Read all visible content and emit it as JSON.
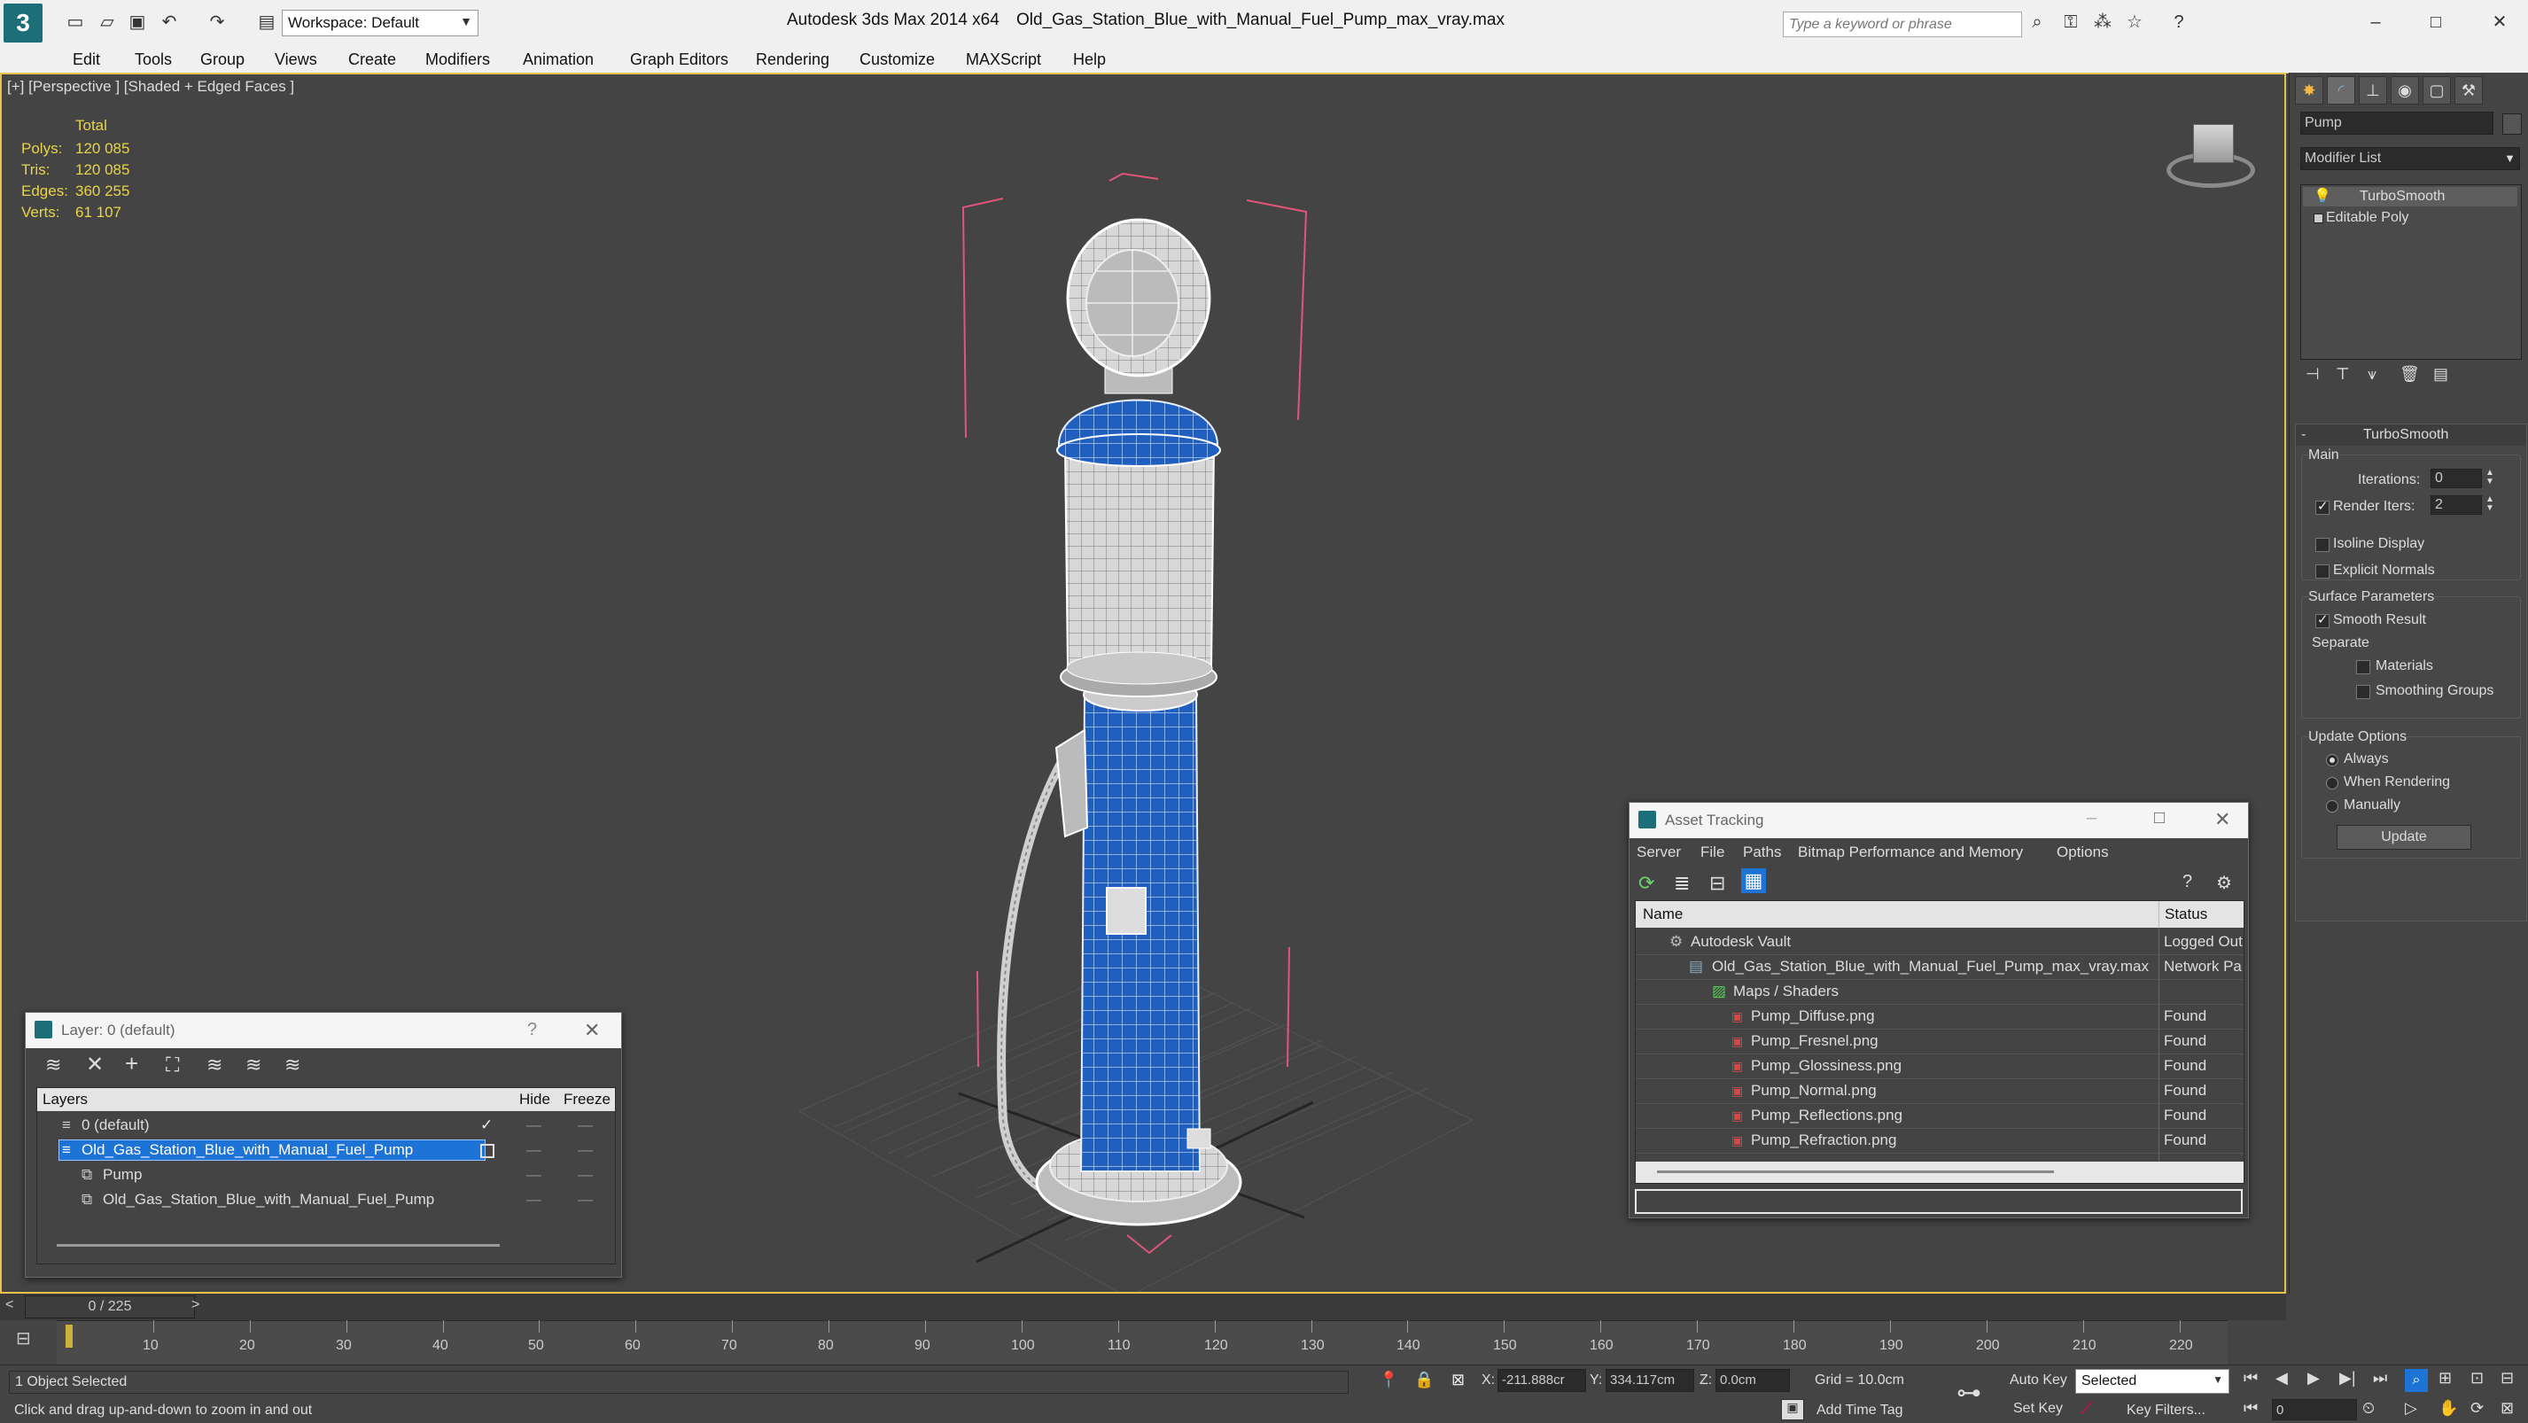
{
  "app": {
    "title": "Autodesk 3ds Max  2014 x64",
    "file": "Old_Gas_Station_Blue_with_Manual_Fuel_Pump_max_vray.max",
    "workspace": "Workspace: Default",
    "search_placeholder": "Type a keyword or phrase"
  },
  "menu": [
    "Edit",
    "Tools",
    "Group",
    "Views",
    "Create",
    "Modifiers",
    "Animation",
    "Graph Editors",
    "Rendering",
    "Customize",
    "MAXScript",
    "Help"
  ],
  "viewport": {
    "label": "[+] [Perspective ] [Shaded + Edged Faces ]",
    "stats_header": "Total",
    "stats": [
      {
        "label": "Polys:",
        "value": "120 085"
      },
      {
        "label": "Tris:",
        "value": "120 085"
      },
      {
        "label": "Edges:",
        "value": "360 255"
      },
      {
        "label": "Verts:",
        "value": "61 107"
      }
    ]
  },
  "command_panel": {
    "object_name": "Pump",
    "modifier_list": "Modifier List",
    "stack": [
      "TurboSmooth",
      "Editable Poly"
    ],
    "rollout_title": "TurboSmooth",
    "main_label": "Main",
    "iterations_label": "Iterations:",
    "iterations_value": "0",
    "render_iters_label": "Render Iters:",
    "render_iters_value": "2",
    "isoline": "Isoline Display",
    "explicit_normals": "Explicit Normals",
    "surface_params": "Surface Parameters",
    "smooth_result": "Smooth Result",
    "separate": "Separate",
    "materials": "Materials",
    "smoothing_groups": "Smoothing Groups",
    "update_options": "Update Options",
    "always": "Always",
    "when_rendering": "When Rendering",
    "manually": "Manually",
    "update_button": "Update"
  },
  "layer_window": {
    "title": "Layer: 0 (default)",
    "col_layers": "Layers",
    "col_hide": "Hide",
    "col_freeze": "Freeze",
    "rows": [
      {
        "label": "0 (default)",
        "indent": 1
      },
      {
        "label": "Old_Gas_Station_Blue_with_Manual_Fuel_Pump",
        "indent": 1,
        "selected": true
      },
      {
        "label": "Pump",
        "indent": 2
      },
      {
        "label": "Old_Gas_Station_Blue_with_Manual_Fuel_Pump",
        "indent": 2
      }
    ]
  },
  "asset_window": {
    "title": "Asset Tracking",
    "menu": [
      "Server",
      "File",
      "Paths",
      "Bitmap Performance and Memory",
      "Options"
    ],
    "col_name": "Name",
    "col_status": "Status",
    "rows": [
      {
        "name": "Autodesk Vault",
        "status": "Logged Out",
        "indent": 1
      },
      {
        "name": "Old_Gas_Station_Blue_with_Manual_Fuel_Pump_max_vray.max",
        "status": "Network Pa",
        "indent": 2
      },
      {
        "name": "Maps / Shaders",
        "status": "",
        "indent": 3
      },
      {
        "name": "Pump_Diffuse.png",
        "status": "Found",
        "indent": 4
      },
      {
        "name": "Pump_Fresnel.png",
        "status": "Found",
        "indent": 4
      },
      {
        "name": "Pump_Glossiness.png",
        "status": "Found",
        "indent": 4
      },
      {
        "name": "Pump_Normal.png",
        "status": "Found",
        "indent": 4
      },
      {
        "name": "Pump_Reflections.png",
        "status": "Found",
        "indent": 4
      },
      {
        "name": "Pump_Refraction.png",
        "status": "Found",
        "indent": 4
      }
    ]
  },
  "timeline": {
    "frame": "0 / 225",
    "ticks": [
      "10",
      "20",
      "30",
      "40",
      "50",
      "60",
      "70",
      "80",
      "90",
      "100",
      "110",
      "120",
      "130",
      "140",
      "150",
      "160",
      "170",
      "180",
      "190",
      "200",
      "210",
      "220"
    ]
  },
  "status": {
    "selection": "1 Object Selected",
    "prompt": "Click and drag up-and-down to zoom in and out",
    "x_label": "X:",
    "x_value": "-211.888cr",
    "y_label": "Y:",
    "y_value": "334.117cm",
    "z_label": "Z:",
    "z_value": "0.0cm",
    "grid": "Grid = 10.0cm",
    "add_time_tag": "Add Time Tag",
    "auto_key": "Auto Key",
    "set_key": "Set Key",
    "key_mode": "Selected",
    "key_filters": "Key Filters...",
    "frame_value": "0"
  }
}
